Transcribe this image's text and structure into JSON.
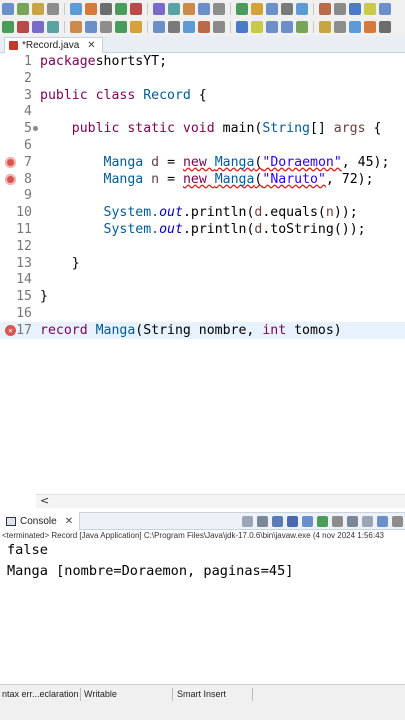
{
  "editor": {
    "tab_label": "*Record.java",
    "lines": [
      {
        "n": "1",
        "segs": [
          [
            "kw",
            "package"
          ],
          [
            "",
            "shortsYT;"
          ]
        ]
      },
      {
        "n": "2",
        "segs": []
      },
      {
        "n": "3",
        "segs": [
          [
            "kw",
            "public class "
          ],
          [
            "typ",
            "Record"
          ],
          [
            "",
            " {"
          ]
        ]
      },
      {
        "n": "4",
        "segs": []
      },
      {
        "n": "5",
        "segs": [
          [
            "",
            "    "
          ],
          [
            "kw",
            "public static void "
          ],
          [
            "",
            "main("
          ],
          [
            "typ",
            "String"
          ],
          [
            "",
            "[] "
          ],
          [
            "var",
            "args"
          ],
          [
            "",
            " {"
          ]
        ]
      },
      {
        "n": "6",
        "segs": []
      },
      {
        "n": "7",
        "segs": [
          [
            "",
            "        "
          ],
          [
            "typ",
            "Manga "
          ],
          [
            "var",
            "d"
          ],
          [
            "",
            " = "
          ],
          [
            "kw",
            "new "
          ],
          [
            "typ",
            "Manga"
          ],
          [
            "",
            "("
          ],
          [
            "str",
            "\"Doraemon\""
          ],
          [
            "",
            ", 45);"
          ]
        ]
      },
      {
        "n": "8",
        "segs": [
          [
            "",
            "        "
          ],
          [
            "typ",
            "Manga "
          ],
          [
            "var",
            "n"
          ],
          [
            "",
            " = "
          ],
          [
            "kw",
            "new "
          ],
          [
            "typ",
            "Manga"
          ],
          [
            "",
            "("
          ],
          [
            "str",
            "\"Naruto\""
          ],
          [
            "",
            ", 72);"
          ]
        ]
      },
      {
        "n": "9",
        "segs": []
      },
      {
        "n": "10",
        "segs": [
          [
            "",
            "        "
          ],
          [
            "typ",
            "System."
          ],
          [
            "fld",
            "out"
          ],
          [
            "",
            ".println("
          ],
          [
            "var",
            "d"
          ],
          [
            "",
            ".equals("
          ],
          [
            "var",
            "n"
          ],
          [
            "",
            "));"
          ]
        ]
      },
      {
        "n": "11",
        "segs": [
          [
            "",
            "        "
          ],
          [
            "typ",
            "System."
          ],
          [
            "fld",
            "out"
          ],
          [
            "",
            ".println("
          ],
          [
            "var",
            "d"
          ],
          [
            "",
            ".toString());"
          ]
        ]
      },
      {
        "n": "12",
        "segs": []
      },
      {
        "n": "13",
        "segs": [
          [
            "",
            "    }"
          ]
        ]
      },
      {
        "n": "14",
        "segs": []
      },
      {
        "n": "15",
        "segs": [
          [
            "",
            "}"
          ]
        ]
      },
      {
        "n": "16",
        "segs": []
      },
      {
        "n": "17",
        "segs": [
          [
            "kw",
            "record "
          ],
          [
            "typ",
            "Manga"
          ],
          [
            "",
            "(String nombre, "
          ],
          [
            "kw",
            "int "
          ],
          [
            "",
            "tomos)"
          ]
        ]
      }
    ]
  },
  "console": {
    "tab_label": "Console",
    "status": "<terminated> Record [Java Application] C:\\Program Files\\Java\\jdk-17.0.6\\bin\\javaw.exe  (4 nov 2024 1:56:43",
    "output": [
      "false",
      "Manga [nombre=Doraemon, paginas=45]"
    ]
  },
  "statusbar": {
    "error_summary": "ntax err...eclaration",
    "mode": "Writable",
    "insert": "Smart Insert"
  },
  "colors": {
    "keyword": "#7f0055",
    "string": "#2a00ff",
    "field": "#0000c0",
    "type": "#005c99",
    "error": "#d9534f"
  }
}
